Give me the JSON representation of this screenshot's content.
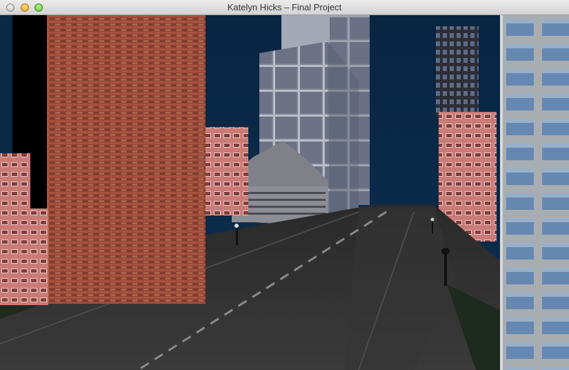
{
  "window": {
    "title": "Katelyn Hicks – Final Project"
  },
  "viewport": {
    "scene_description_visible": false
  },
  "colors": {
    "sky": "#0a2a47",
    "road": "#2b2b2b",
    "brick": "#a44f3e",
    "glass_tower": "#8a8f9e",
    "blue_windows": "#6f93c1"
  }
}
